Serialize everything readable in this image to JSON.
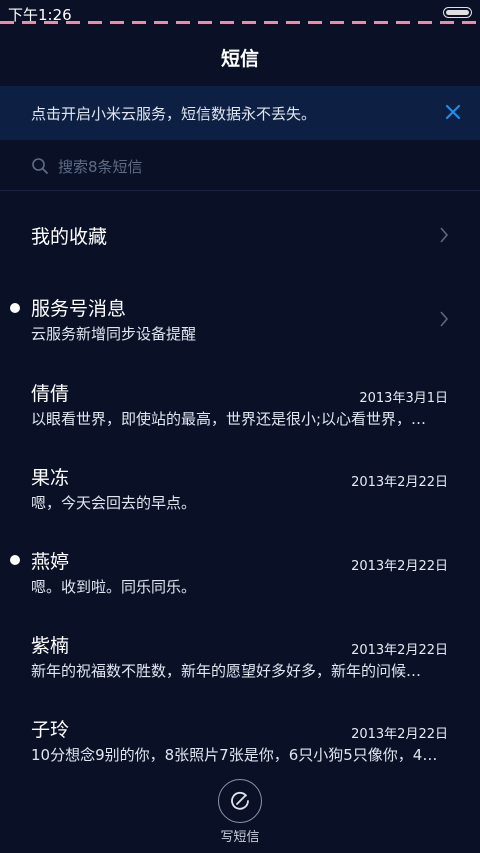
{
  "status": {
    "time": "下午1:26"
  },
  "header": {
    "title": "短信"
  },
  "banner": {
    "text": "点击开启小米云服务，短信数据永不丢失。"
  },
  "search": {
    "placeholder": "搜索8条短信"
  },
  "favorites": {
    "label": "我的收藏"
  },
  "service": {
    "name": "服务号消息",
    "preview": "云服务新增同步设备提醒",
    "unread": true
  },
  "messages": [
    {
      "name": "倩倩",
      "date": "2013年3月1日",
      "preview": "以眼看世界，即使站的最高，世界还是很小;以心看世界，…",
      "unread": false
    },
    {
      "name": "果冻",
      "date": "2013年2月22日",
      "preview": "嗯，今天会回去的早点。",
      "unread": false
    },
    {
      "name": "燕婷",
      "date": "2013年2月22日",
      "preview": "嗯。收到啦。同乐同乐。",
      "unread": true
    },
    {
      "name": "紫楠",
      "date": "2013年2月22日",
      "preview": "新年的祝福数不胜数，新年的愿望好多好多，新年的问候…",
      "unread": false
    },
    {
      "name": "子玲",
      "date": "2013年2月22日",
      "preview": "10分想念9别的你，8张照片7张是你，6只小狗5只像你，4…",
      "unread": false
    }
  ],
  "compose": {
    "label": "写短信"
  },
  "colors": {
    "background": "#0a1126",
    "banner": "#0d2043",
    "accent": "#1e8ce8",
    "status_dash": "#f08aa8"
  }
}
